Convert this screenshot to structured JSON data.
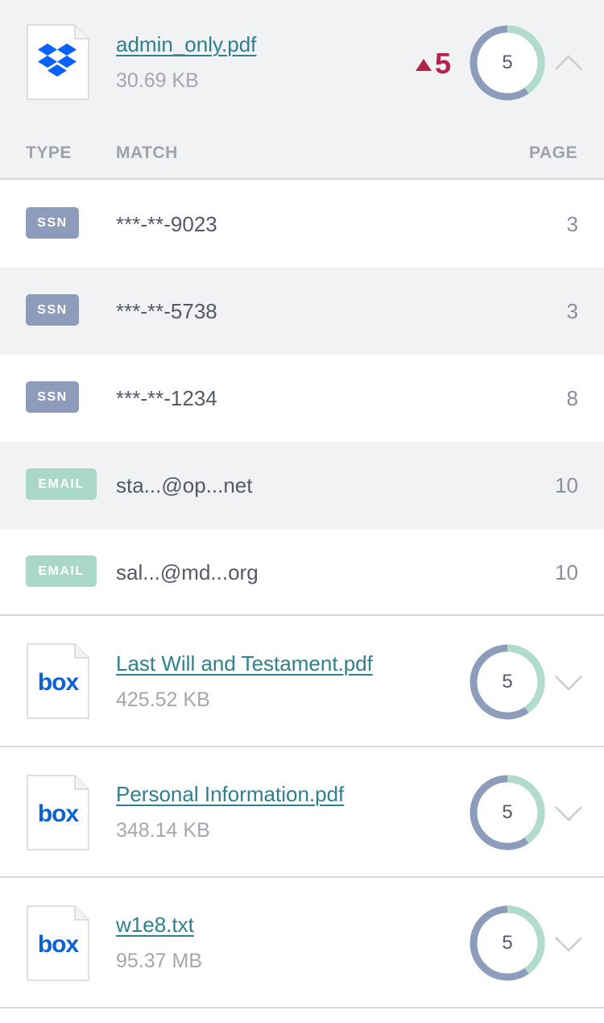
{
  "files": [
    {
      "name": "admin_only.pdf",
      "size": "30.69 KB",
      "source": "dropbox-icon",
      "score": "5",
      "alert_count": "5",
      "expanded": true
    },
    {
      "name": "Last Will and Testament.pdf",
      "size": "425.52 KB",
      "source": "box-icon",
      "score": "5",
      "expanded": false
    },
    {
      "name": "Personal Information.pdf",
      "size": "348.14 KB",
      "source": "box-icon",
      "score": "5",
      "expanded": false
    },
    {
      "name": "w1e8.txt",
      "size": "95.37 MB",
      "source": "box-icon",
      "score": "5",
      "expanded": false
    }
  ],
  "matches_table": {
    "headers": {
      "type": "TYPE",
      "match": "MATCH",
      "page": "PAGE"
    },
    "rows": [
      {
        "type": "SSN",
        "match": "***-**-9023",
        "page": "3"
      },
      {
        "type": "SSN",
        "match": "***-**-5738",
        "page": "3"
      },
      {
        "type": "SSN",
        "match": "***-**-1234",
        "page": "8"
      },
      {
        "type": "EMAIL",
        "match": "sta...@op...net",
        "page": "10"
      },
      {
        "type": "EMAIL",
        "match": "sal...@md...org",
        "page": "10"
      }
    ]
  },
  "colors": {
    "ssn_badge": "#8e9cbc",
    "email_badge": "#a9d8c6",
    "alert": "#b3234a",
    "link": "#2f7f8d",
    "donut_blue": "#8e9cbc",
    "donut_green": "#b1dccb"
  }
}
